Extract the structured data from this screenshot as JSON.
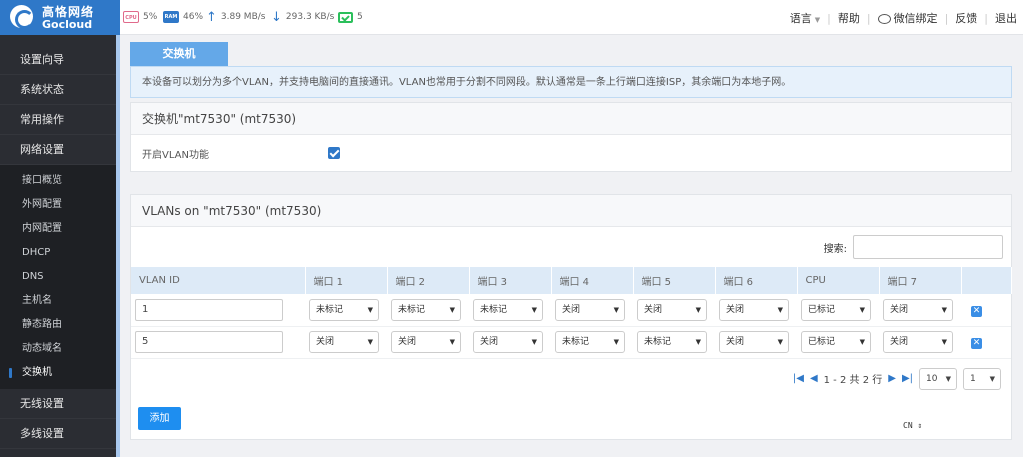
{
  "brand": {
    "name_cn": "高恪网络",
    "name_en": "Gocloud",
    "accent": "#2f78c8"
  },
  "status": {
    "cpu_label": "CPU",
    "cpu": "5%",
    "ram_label": "RAM",
    "ram": "46%",
    "upload": "3.89 MB/s",
    "download": "293.3 KB/s",
    "terminals": "5"
  },
  "topmenu": [
    "语言",
    "帮助",
    "微信绑定",
    "反馈",
    "退出"
  ],
  "sidebar": {
    "top_items": [
      "设置向导",
      "系统状态",
      "常用操作",
      "网络设置"
    ],
    "sub_items": [
      "接口概览",
      "外网配置",
      "内网配置",
      "DHCP",
      "DNS",
      "主机名",
      "静态路由",
      "动态域名",
      "交换机"
    ],
    "active_sub": "交换机",
    "bottom_items": [
      "无线设置",
      "多线设置"
    ]
  },
  "tab": {
    "label": "交换机"
  },
  "notice": "本设备可以划分为多个VLAN，并支持电脑间的直接通讯。VLAN也常用于分割不同网段。默认通常是一条上行端口连接ISP，其余端口为本地子网。",
  "switch_panel": {
    "title": "交换机\"mt7530\" (mt7530)",
    "enable_label": "开启VLAN功能",
    "enabled": true
  },
  "vlan_panel": {
    "title": "VLANs on \"mt7530\" (mt7530)",
    "search_label": "搜索:",
    "search_value": "",
    "columns": [
      "VLAN ID",
      "端口 1",
      "端口 2",
      "端口 3",
      "端口 4",
      "端口 5",
      "端口 6",
      "CPU",
      "端口 7"
    ],
    "rows": [
      {
        "id": "1",
        "ports": [
          "未标记",
          "未标记",
          "未标记",
          "关闭",
          "关闭",
          "关闭",
          "已标记",
          "关闭"
        ]
      },
      {
        "id": "5",
        "ports": [
          "关闭",
          "关闭",
          "关闭",
          "未标记",
          "未标记",
          "关闭",
          "已标记",
          "关闭"
        ]
      }
    ],
    "pager": {
      "summary": "1 - 2 共 2 行",
      "page_size": "10",
      "page": "1"
    },
    "add_label": "添加",
    "lang": "CN"
  }
}
